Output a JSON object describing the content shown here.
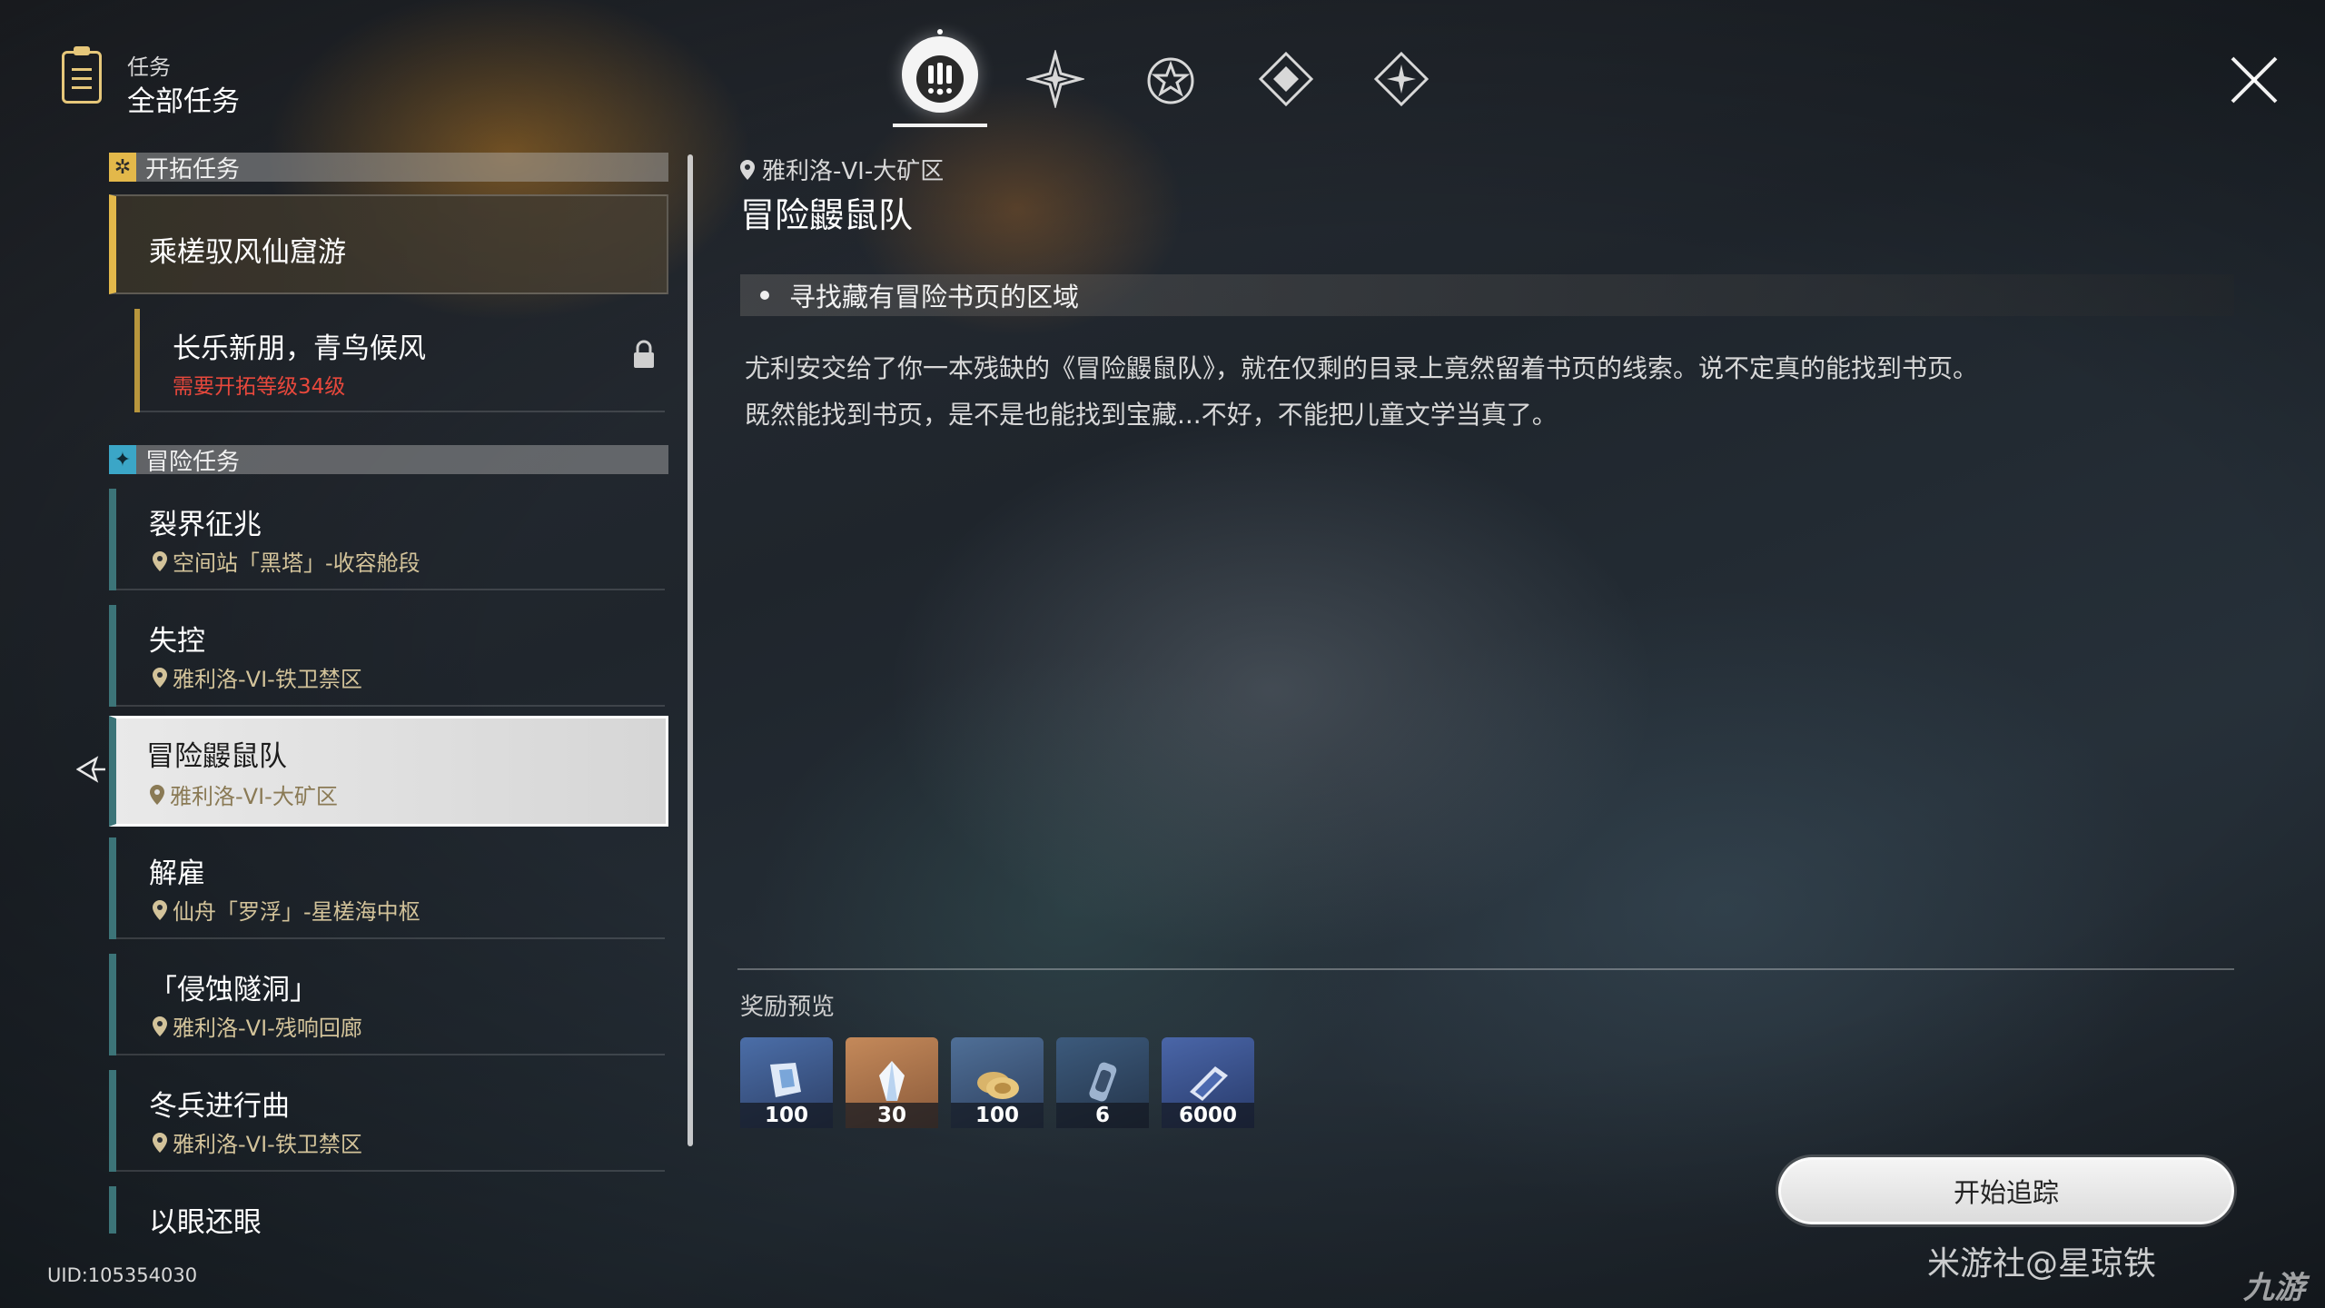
{
  "header": {
    "subtitle": "任务",
    "title": "全部任务"
  },
  "tabs": [
    {
      "icon": "exclamation-icon",
      "active": true
    },
    {
      "icon": "trailblaze-star-icon",
      "active": false
    },
    {
      "icon": "star-outline-icon",
      "active": false
    },
    {
      "icon": "diamond-icon",
      "active": false
    },
    {
      "icon": "sparkle-diamond-icon",
      "active": false
    }
  ],
  "categories": {
    "trailblaze": {
      "label": "开拓任务"
    },
    "adventure": {
      "label": "冒险任务"
    }
  },
  "trailblaze_quests": [
    {
      "name": "乘槎驭风仙窟游"
    },
    {
      "name": "长乐新朋，青鸟候风",
      "requirement": "需要开拓等级34级",
      "locked": true
    }
  ],
  "adventure_quests": [
    {
      "name": "裂界征兆",
      "location": "空间站「黑塔」-收容舱段"
    },
    {
      "name": "失控",
      "location": "雅利洛-VI-铁卫禁区"
    },
    {
      "name": "冒险鼹鼠队",
      "location": "雅利洛-VI-大矿区",
      "selected": true
    },
    {
      "name": "解雇",
      "location": "仙舟「罗浮」-星槎海中枢"
    },
    {
      "name": "「侵蚀隧洞」",
      "location": "雅利洛-VI-残响回廊"
    },
    {
      "name": "冬兵进行曲",
      "location": "雅利洛-VI-铁卫禁区"
    },
    {
      "name": "以眼还眼"
    }
  ],
  "detail": {
    "location": "雅利洛-VI-大矿区",
    "title": "冒险鼹鼠队",
    "objective": "寻找藏有冒险书页的区域",
    "description_line1": "尤利安交给了你一本残缺的《冒险鼹鼠队》，就在仅剩的目录上竟然留着书页的线索。说不定真的能找到书页。",
    "description_line2": "既然能找到书页，是不是也能找到宝藏...不好，不能把儿童文学当真了。"
  },
  "rewards": {
    "label": "奖励预览",
    "items": [
      {
        "icon": "trailblaze-exp-icon",
        "count": "100"
      },
      {
        "icon": "stellar-jade-icon",
        "count": "30"
      },
      {
        "icon": "credit-coin-icon",
        "count": "100"
      },
      {
        "icon": "material-canister-icon",
        "count": "6"
      },
      {
        "icon": "book-material-icon",
        "count": "6000"
      }
    ]
  },
  "actions": {
    "track_label": "开始追踪"
  },
  "footer": {
    "uid": "UID:105354030",
    "watermark": "米游社@星琼铁",
    "logo": "九游"
  },
  "colors": {
    "accent_gold": "#e3b84a",
    "adventure_teal": "#3c7478",
    "location_text": "#d3c39a",
    "requirement_red": "#e8483c"
  }
}
